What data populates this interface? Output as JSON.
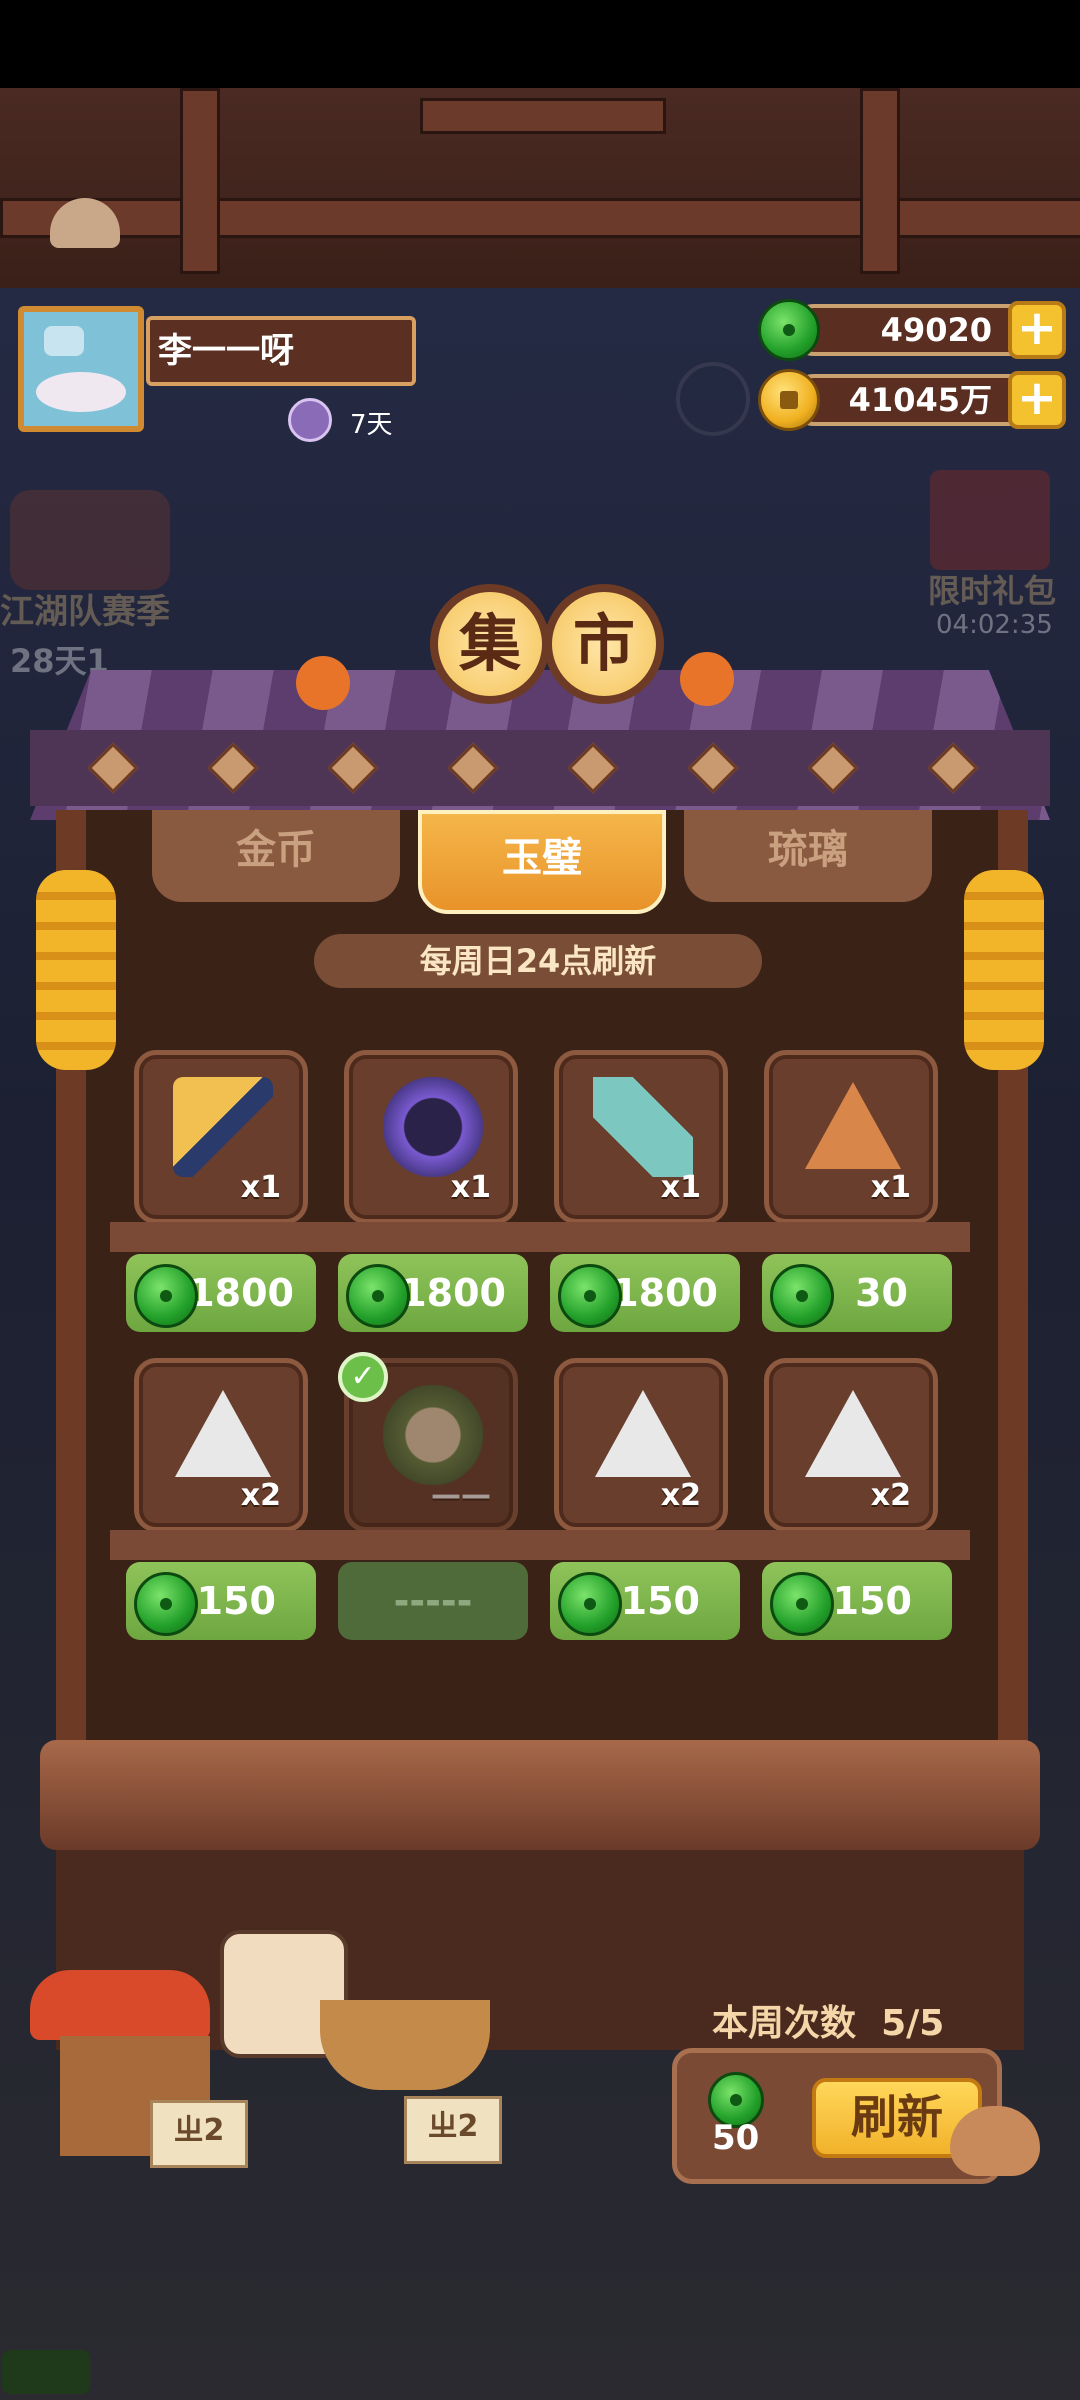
{
  "player": {
    "name": "李一一呀",
    "days": "7天"
  },
  "currency": {
    "jade": "49020",
    "gold": "41045万",
    "plus_icon": "plus-icon"
  },
  "side_events": {
    "left_label": "江湖队赛季",
    "left_timer": "28天1",
    "right_label": "限时礼包",
    "right_timer": "04:02:35"
  },
  "shop": {
    "title_chars": [
      "集",
      "市"
    ],
    "tabs": [
      {
        "label": "金币",
        "active": false
      },
      {
        "label": "玉璧",
        "active": true
      },
      {
        "label": "琉璃",
        "active": false
      }
    ],
    "refresh_note": "每周日24点刷新",
    "rows": [
      [
        {
          "icon": "feather-duster-icon",
          "qty": "x1",
          "price": "1800"
        },
        {
          "icon": "purple-mirror-icon",
          "qty": "x1",
          "price": "1800"
        },
        {
          "icon": "paper-umbrella-icon",
          "qty": "x1",
          "price": "1800"
        },
        {
          "icon": "bronze-triangle-charm-icon",
          "qty": "x1",
          "price": "30"
        }
      ],
      [
        {
          "icon": "white-triangle-charm-icon",
          "qty": "x2",
          "price": "150"
        },
        {
          "icon": "character-avatar-icon",
          "qty": "——",
          "price": "-----",
          "sold": true
        },
        {
          "icon": "crab-triangle-charm-icon",
          "qty": "x2",
          "price": "150"
        },
        {
          "icon": "swirl-triangle-charm-icon",
          "qty": "x2",
          "price": "150"
        }
      ]
    ]
  },
  "footer": {
    "weekly_label": "本周次数",
    "weekly_value": "5/5",
    "refresh_cost": "50",
    "refresh_label": "刷新",
    "sign_left": "ㄓ2",
    "sign_right": "ㄓ2"
  }
}
